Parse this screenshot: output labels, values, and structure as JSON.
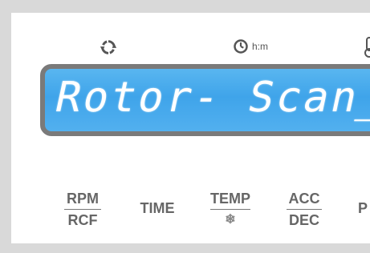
{
  "icons": {
    "rotor": "rotate-icon",
    "time": "clock-icon",
    "time_label": "h:m",
    "temp": "thermometer-icon"
  },
  "display": {
    "text": "Rotor- Scan__",
    "color": "#4aaaee"
  },
  "buttons": {
    "rpm_top": "RPM",
    "rpm_bottom": "RCF",
    "time": "TIME",
    "temp_top": "TEMP",
    "temp_bottom": "❄",
    "acc_top": "ACC",
    "acc_bottom": "DEC",
    "prog": "P"
  }
}
